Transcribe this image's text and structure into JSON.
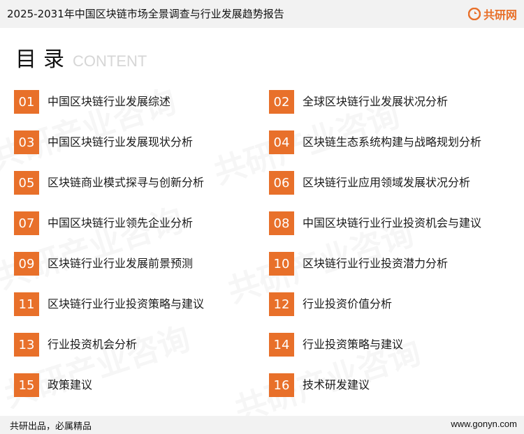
{
  "header": {
    "title": "2025-2031年中国区块链市场全景调查与行业发展趋势报告",
    "brand": "共研网",
    "brand_color": "#e8702a"
  },
  "heading": {
    "main": "目录",
    "sub": "CONTENT"
  },
  "watermark": "共研产业咨询",
  "toc": [
    {
      "num": "01",
      "label": "中国区块链行业发展综述"
    },
    {
      "num": "02",
      "label": "全球区块链行业发展状况分析"
    },
    {
      "num": "03",
      "label": "中国区块链行业发展现状分析"
    },
    {
      "num": "04",
      "label": "区块链生态系统构建与战略规划分析"
    },
    {
      "num": "05",
      "label": "区块链商业模式探寻与创新分析"
    },
    {
      "num": "06",
      "label": "区块链行业应用领域发展状况分析"
    },
    {
      "num": "07",
      "label": "中国区块链行业领先企业分析"
    },
    {
      "num": "08",
      "label": "中国区块链行业行业投资机会与建议"
    },
    {
      "num": "09",
      "label": "区块链行业行业发展前景预测"
    },
    {
      "num": "10",
      "label": "区块链行业行业投资潜力分析"
    },
    {
      "num": "11",
      "label": "区块链行业行业投资策略与建议"
    },
    {
      "num": "12",
      "label": "行业投资价值分析"
    },
    {
      "num": "13",
      "label": "行业投资机会分析"
    },
    {
      "num": "14",
      "label": "行业投资策略与建议"
    },
    {
      "num": "15",
      "label": "政策建议"
    },
    {
      "num": "16",
      "label": "技术研发建议"
    }
  ],
  "footer": {
    "slogan": "共研出品，必属精品",
    "url": "www.gonyn.com"
  }
}
